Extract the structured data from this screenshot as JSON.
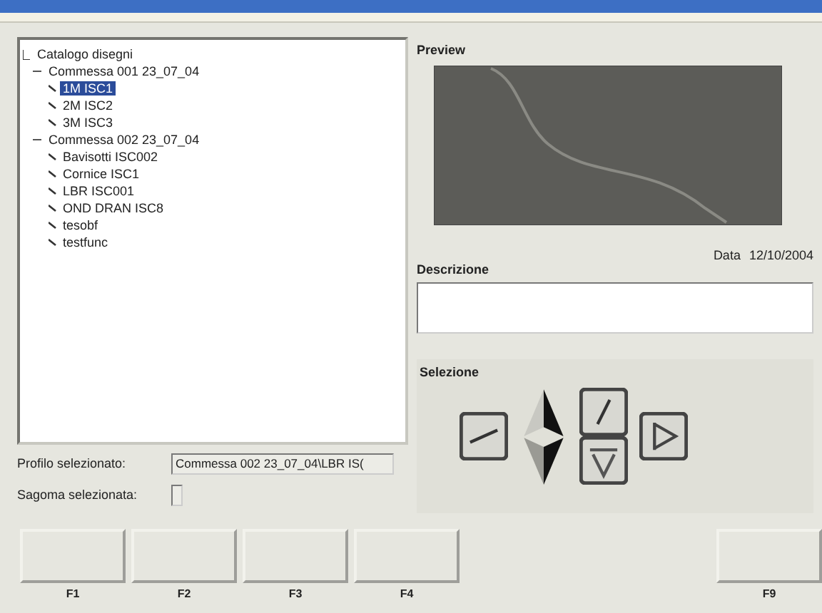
{
  "tree": {
    "label": "Catalogo disegni",
    "children": [
      {
        "label": "Commessa 001 23_07_04",
        "expanded": true,
        "children": [
          {
            "label": "1M ISC1",
            "selected": true
          },
          {
            "label": "2M ISC2",
            "selected": false
          },
          {
            "label": "3M ISC3",
            "selected": false
          }
        ]
      },
      {
        "label": "Commessa 002 23_07_04",
        "expanded": true,
        "children": [
          {
            "label": "Bavisotti ISC002",
            "selected": false
          },
          {
            "label": "Cornice ISC1",
            "selected": false
          },
          {
            "label": "LBR ISC001",
            "selected": false
          },
          {
            "label": "OND DRAN ISC8",
            "selected": false
          },
          {
            "label": "tesobf",
            "selected": false
          },
          {
            "label": "testfunc",
            "selected": false
          }
        ]
      }
    ]
  },
  "preview": {
    "title": "Preview"
  },
  "date": {
    "label": "Data",
    "value": "12/10/2004"
  },
  "description": {
    "label": "Descrizione"
  },
  "selection": {
    "title": "Selezione",
    "buttons": [
      {
        "kind": "diagonal"
      },
      {
        "kind": "triangle-up"
      },
      {
        "kind": "triangle-down"
      },
      {
        "kind": "slash"
      },
      {
        "kind": "funnel"
      },
      {
        "kind": "wedge"
      }
    ]
  },
  "profile": {
    "label": "Profilo selezionato:",
    "value": "Commessa 002 23_07_04\\LBR IS("
  },
  "shape": {
    "label": "Sagoma selezionata:"
  },
  "function_keys": [
    {
      "label": "F1"
    },
    {
      "label": "F2"
    },
    {
      "label": "F3"
    },
    {
      "label": "F4"
    },
    {
      "label": "F9"
    }
  ]
}
